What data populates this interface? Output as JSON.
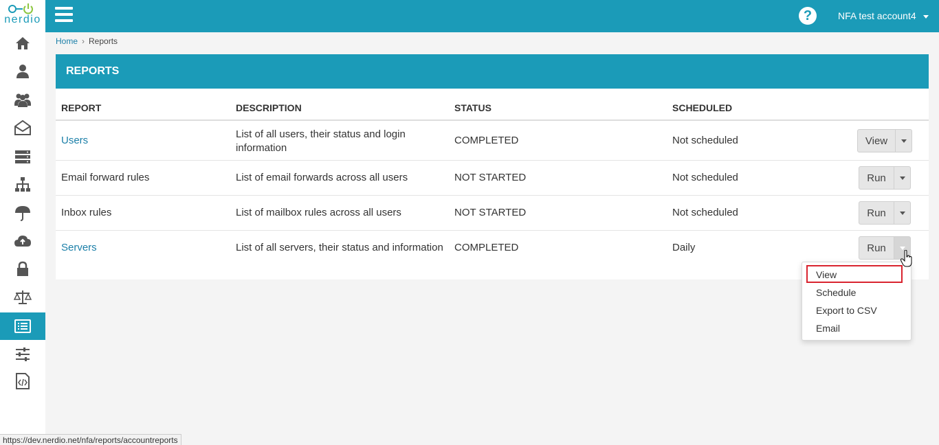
{
  "app": {
    "logo_text": "nerdio"
  },
  "topbar": {
    "help_label": "?",
    "account_name": "NFA test account4"
  },
  "breadcrumb": {
    "home": "Home",
    "separator": "›",
    "current": "Reports"
  },
  "panel": {
    "title": "REPORTS"
  },
  "table": {
    "headers": [
      "REPORT",
      "DESCRIPTION",
      "STATUS",
      "SCHEDULED"
    ],
    "rows": [
      {
        "report": "Users",
        "description": "List of all users, their status and login information",
        "status": "COMPLETED",
        "scheduled": "Not scheduled",
        "action": "View"
      },
      {
        "report": "Email forward rules",
        "description": "List of email forwards across all users",
        "status": "NOT STARTED",
        "scheduled": "Not scheduled",
        "action": "Run"
      },
      {
        "report": "Inbox rules",
        "description": "List of mailbox rules across all users",
        "status": "NOT STARTED",
        "scheduled": "Not scheduled",
        "action": "Run"
      },
      {
        "report": "Servers",
        "description": "List of all servers, their status and information",
        "status": "COMPLETED",
        "scheduled": "Daily",
        "action": "Run"
      }
    ]
  },
  "dropdown": {
    "items": [
      "View",
      "Schedule",
      "Export to CSV",
      "Email"
    ]
  },
  "status_bar": {
    "url": "https://dev.nerdio.net/nfa/reports/accountreports"
  },
  "sidebar": {
    "icons": [
      "home-icon",
      "user-icon",
      "group-icon",
      "mail-icon",
      "server-icon",
      "network-icon",
      "umbrella-icon",
      "cloud-upload-icon",
      "lock-icon",
      "scale-icon",
      "reports-icon",
      "sliders-icon",
      "code-file-icon"
    ]
  },
  "colors": {
    "brand": "#1b9bb8",
    "link": "#1b7fa8",
    "highlight": "#d9232e"
  }
}
